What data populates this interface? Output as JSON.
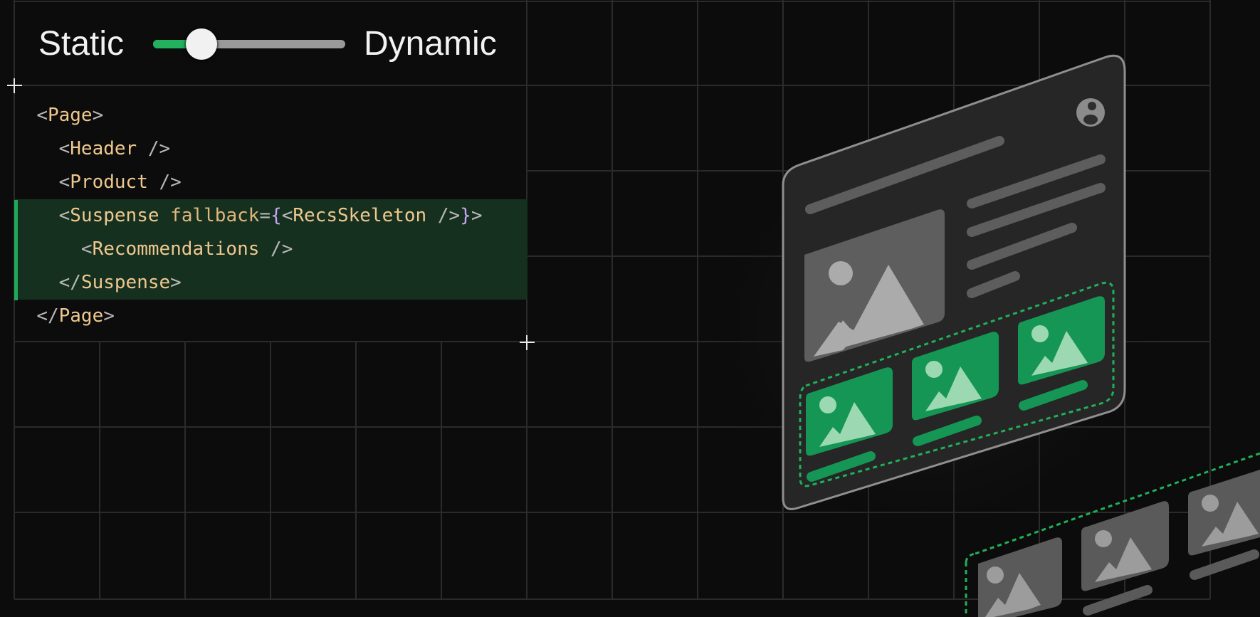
{
  "toggle": {
    "left_label": "Static",
    "right_label": "Dynamic",
    "level": 0.25
  },
  "code": {
    "lines": [
      {
        "text": "<Page>",
        "highlighted": false
      },
      {
        "text": "  <Header />",
        "highlighted": false
      },
      {
        "text": "  <Product />",
        "highlighted": false
      },
      {
        "text": "  <Suspense fallback={<RecsSkeleton />}>",
        "highlighted": true
      },
      {
        "text": "    <Recommendations />",
        "highlighted": true
      },
      {
        "text": "  </Suspense>",
        "highlighted": true
      },
      {
        "text": "</Page>",
        "highlighted": false
      }
    ]
  },
  "colors": {
    "background": "#0c0c0c",
    "accent_green": "#22b15c",
    "highlight_bg": "#16301f",
    "tag": "#efc88f",
    "brace": "#c9a4f5"
  },
  "icons": {
    "avatar": "user-avatar-icon",
    "image": "image-placeholder-icon",
    "crosshair": "crosshair-icon"
  }
}
